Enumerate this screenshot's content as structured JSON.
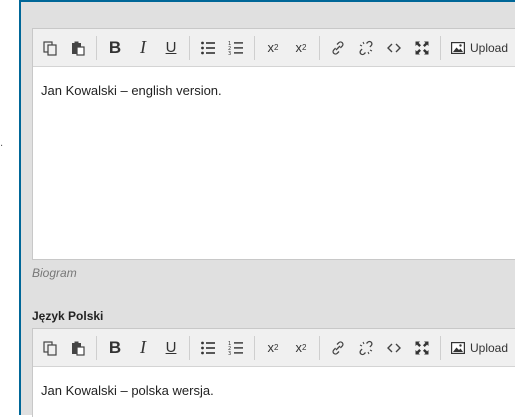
{
  "toolbar": {
    "upload_label": "Upload"
  },
  "editor_en": {
    "content": "Jan Kowalski – english version."
  },
  "helper_text": "Biogram",
  "section_pl": {
    "label": "Język Polski"
  },
  "editor_pl": {
    "content": "Jan Kowalski – polska wersja."
  },
  "colors": {
    "accent_border": "#006798",
    "panel_bg": "#e0e0e0",
    "toolbar_bg": "#f0f0f0"
  },
  "icons": [
    "copy-icon",
    "paste-icon",
    "bold-icon",
    "italic-icon",
    "underline-icon",
    "bullet-list-icon",
    "numbered-list-icon",
    "superscript-icon",
    "subscript-icon",
    "link-icon",
    "unlink-icon",
    "code-icon",
    "fullscreen-icon",
    "image-upload-icon"
  ]
}
